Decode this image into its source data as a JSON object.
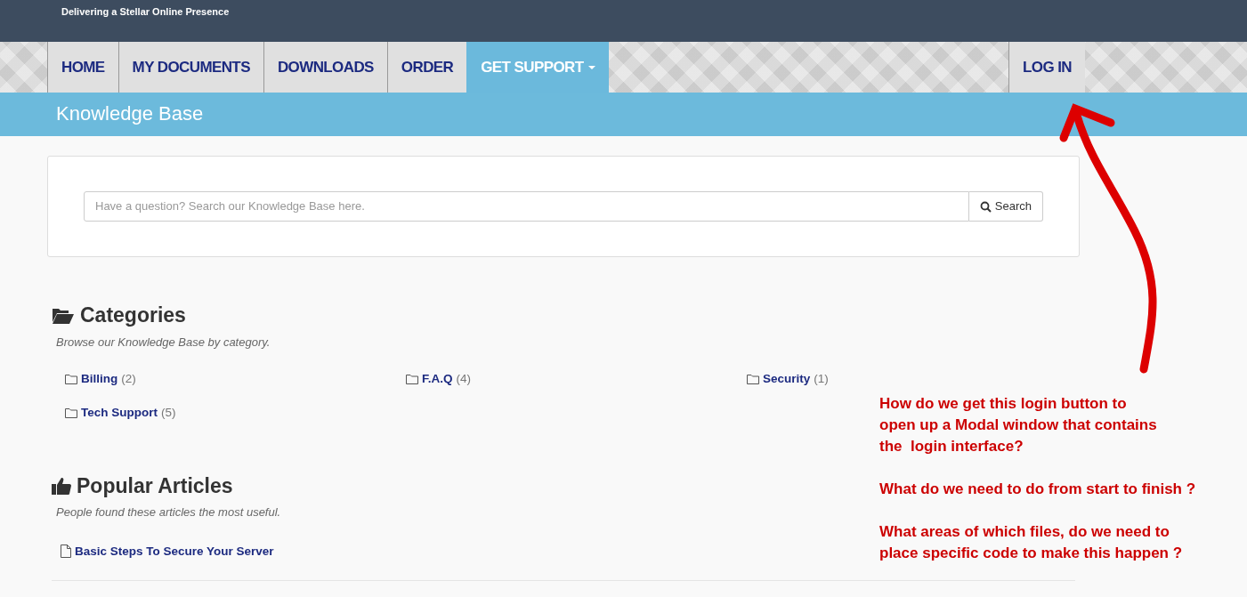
{
  "header": {
    "tagline": "Delivering a Stellar Online Presence"
  },
  "nav": {
    "items": [
      {
        "label": "HOME",
        "selected": false,
        "dropdown": false
      },
      {
        "label": "MY DOCUMENTS",
        "selected": false,
        "dropdown": false
      },
      {
        "label": "DOWNLOADS",
        "selected": false,
        "dropdown": false
      },
      {
        "label": "ORDER",
        "selected": false,
        "dropdown": false
      },
      {
        "label": "GET SUPPORT",
        "selected": true,
        "dropdown": true
      }
    ],
    "right_items": [
      {
        "label": "LOG IN",
        "selected": false,
        "dropdown": false
      }
    ]
  },
  "page_title": "Knowledge Base",
  "search": {
    "placeholder": "Have a question? Search our Knowledge Base here.",
    "button": "Search"
  },
  "categories": {
    "title": "Categories",
    "subtitle": "Browse our Knowledge Base by category.",
    "items": [
      {
        "name": "Billing",
        "count": "(2)"
      },
      {
        "name": "F.A.Q",
        "count": "(4)"
      },
      {
        "name": "Security",
        "count": "(1)"
      },
      {
        "name": "Tech Support",
        "count": "(5)"
      }
    ]
  },
  "popular": {
    "title": "Popular Articles",
    "subtitle": "People found these articles the most useful.",
    "articles": [
      "Basic Steps To Secure Your Server"
    ]
  },
  "annotation": {
    "paragraphs": [
      [
        "How do we get this login button to",
        "open up a Modal window that contains",
        "the  login interface?"
      ],
      [
        "What do we need to do from start to finish ?"
      ],
      [
        "What areas of which files, do we need to",
        "place specific code to make this happen ?"
      ]
    ]
  }
}
